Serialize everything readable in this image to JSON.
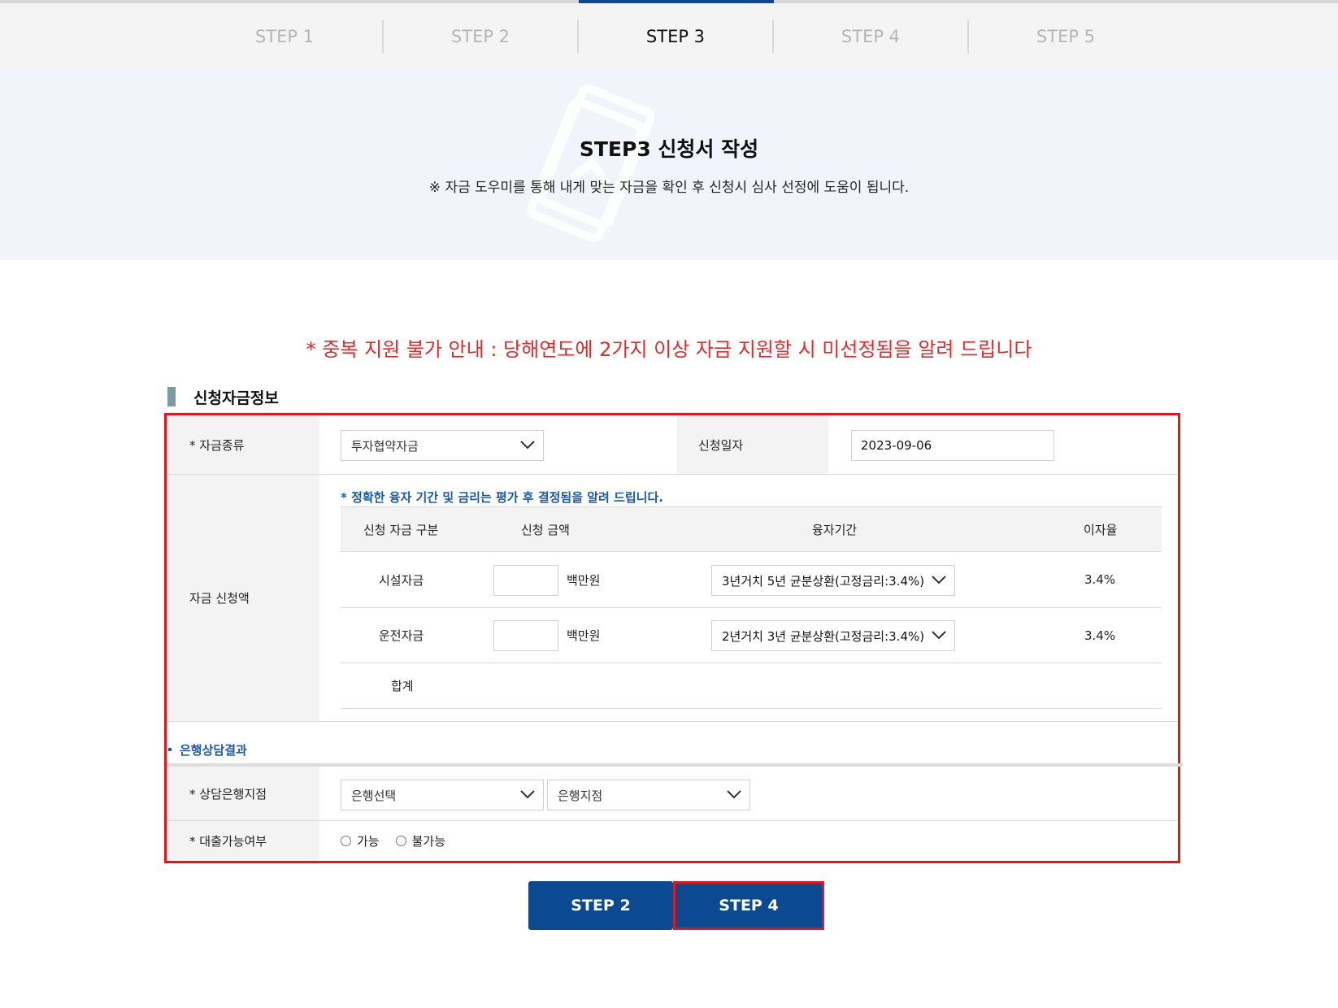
{
  "steps": [
    {
      "label": "STEP 1",
      "active": false
    },
    {
      "label": "STEP 2",
      "active": false
    },
    {
      "label": "STEP 3",
      "active": true
    },
    {
      "label": "STEP 4",
      "active": false
    },
    {
      "label": "STEP 5",
      "active": false
    }
  ],
  "banner": {
    "title": "STEP3 신청서 작성",
    "subtitle": "※ 자금 도우미를 통해 내게 맞는 자금을 확인 후 신청시 심사 선정에 도움이 됩니다."
  },
  "notice": "* 중복 지원 불가 안내 : 당해연도에 2가지 이상 자금 지원할 시 미선정됨을 알려 드립니다",
  "section_title": "신청자금정보",
  "form": {
    "fund_type": {
      "label": "* 자금종류",
      "value": "투자협약자금"
    },
    "apply_date": {
      "label": "신청일자",
      "value": "2023-09-06"
    },
    "fund_amount": {
      "label": "자금 신청액",
      "note": "* 정확한 융자 기간 및 금리는 평가 후 결정됨을 알려 드립니다.",
      "headers": {
        "category": "신청 자금 구분",
        "amount": "신청 금액",
        "period": "융자기간",
        "rate": "이자율"
      },
      "rows": [
        {
          "category": "시설자금",
          "amount": "",
          "unit": "백만원",
          "period": "3년거치 5년 균분상환(고정금리:3.4%)",
          "rate": "3.4%"
        },
        {
          "category": "운전자금",
          "amount": "",
          "unit": "백만원",
          "period": "2년거치 3년 균분상환(고정금리:3.4%)",
          "rate": "3.4%"
        }
      ],
      "total_label": "합계"
    },
    "bank_section_label": "은행상담결과",
    "bank_branch": {
      "label": "* 상담은행지점",
      "bank_value": "은행선택",
      "branch_value": "은행지점"
    },
    "loan_possible": {
      "label": "* 대출가능여부",
      "options": [
        "가능",
        "불가능"
      ]
    }
  },
  "buttons": {
    "prev": "STEP 2",
    "next": "STEP 4"
  },
  "colors": {
    "primary": "#0b4a92",
    "notice": "#e22b2b",
    "highlight": "#e8141c",
    "link": "#1b5aa7"
  }
}
